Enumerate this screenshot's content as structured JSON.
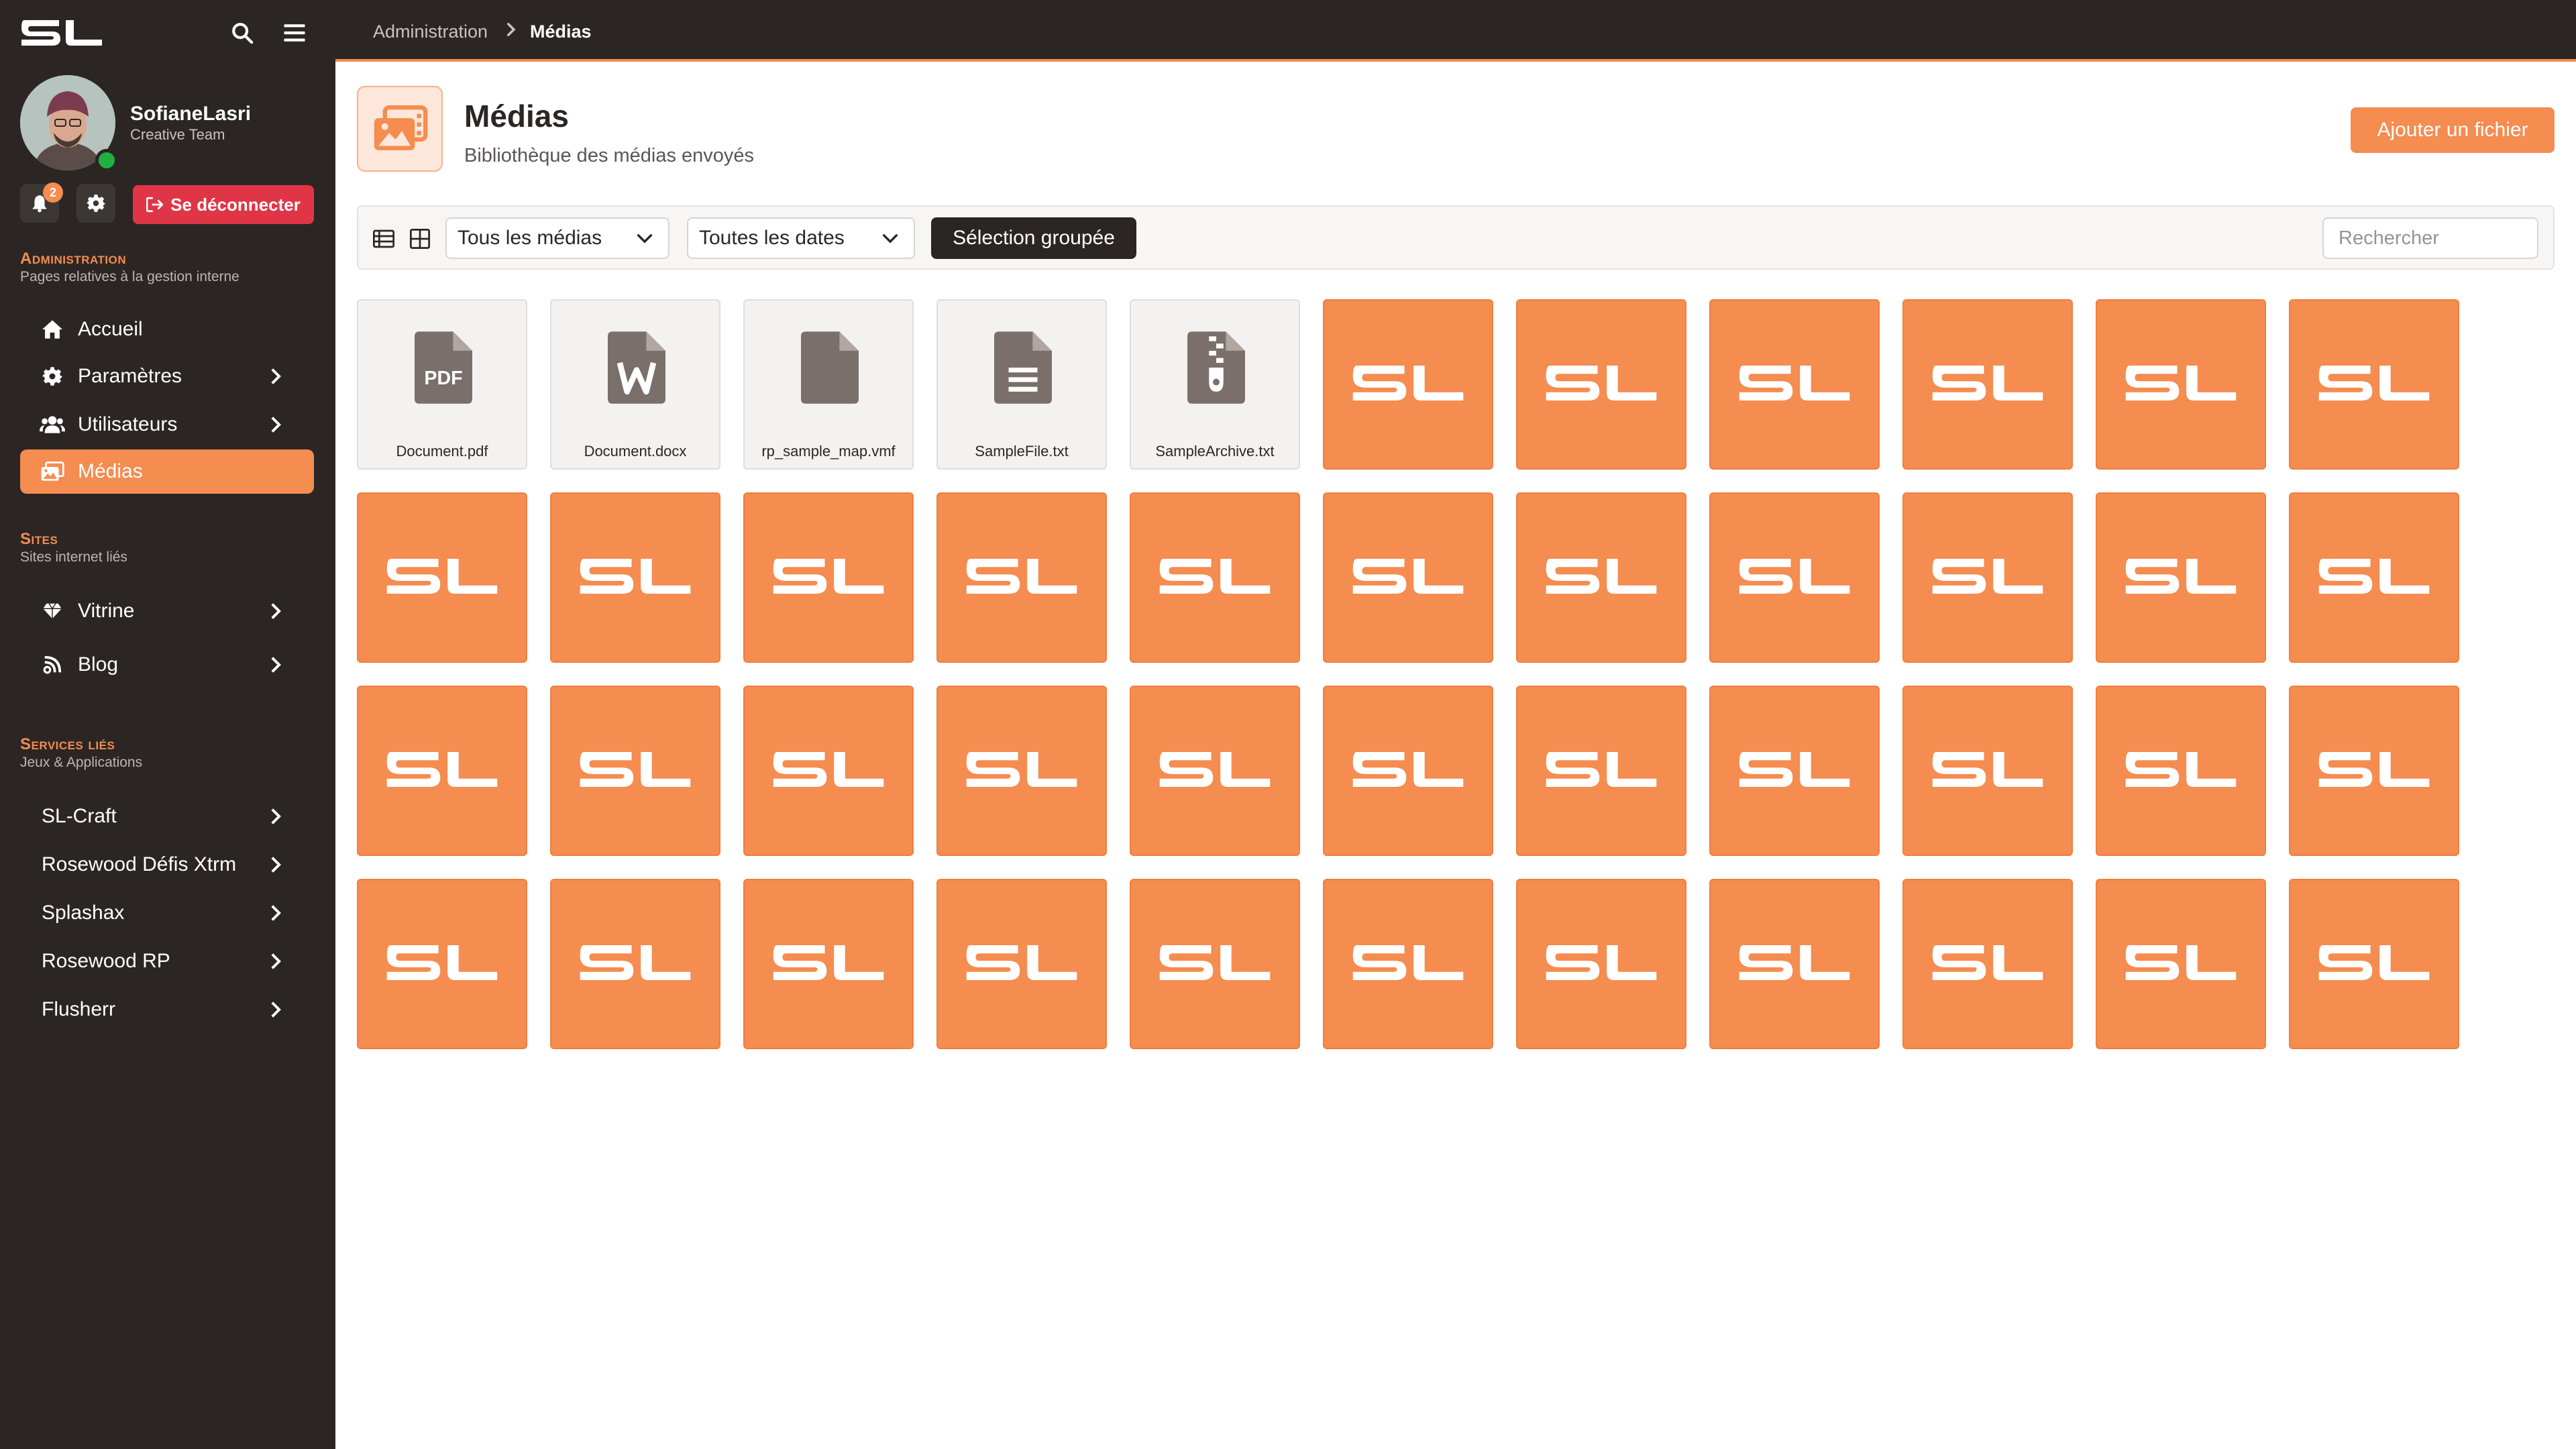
{
  "app": {
    "logo_text": "SL"
  },
  "breadcrumb": {
    "parent": "Administration",
    "current": "Médias"
  },
  "user": {
    "name": "SofianeLasri",
    "team": "Creative Team",
    "notifications": "2",
    "logout_label": "Se déconnecter"
  },
  "sidebar": {
    "sections": [
      {
        "title": "Administration",
        "subtitle": "Pages relatives à la gestion interne"
      },
      {
        "title": "Sites",
        "subtitle": "Sites internet liés"
      },
      {
        "title": "Services liés",
        "subtitle": "Jeux & Applications"
      }
    ],
    "admin_items": [
      {
        "label": "Accueil",
        "icon": "home-icon"
      },
      {
        "label": "Paramètres",
        "icon": "gear-icon"
      },
      {
        "label": "Utilisateurs",
        "icon": "users-icon"
      },
      {
        "label": "Médias",
        "icon": "images-icon"
      }
    ],
    "site_items": [
      {
        "label": "Vitrine",
        "icon": "gem-icon"
      },
      {
        "label": "Blog",
        "icon": "blog-icon"
      }
    ],
    "service_items": [
      {
        "label": "SL-Craft"
      },
      {
        "label": "Rosewood Défis Xtrm"
      },
      {
        "label": "Splashax"
      },
      {
        "label": "Rosewood RP"
      },
      {
        "label": "Flusherr"
      }
    ]
  },
  "page": {
    "title": "Médias",
    "subtitle": "Bibliothèque des médias envoyés",
    "add_button": "Ajouter un fichier"
  },
  "toolbar": {
    "type_filter": "Tous les médias",
    "date_filter": "Toutes les dates",
    "bulk_select": "Sélection groupée",
    "search_placeholder": "Rechercher"
  },
  "files": [
    {
      "name": "Document.pdf",
      "icon": "file-pdf-icon"
    },
    {
      "name": "Document.docx",
      "icon": "file-word-icon"
    },
    {
      "name": "rp_sample_map.vmf",
      "icon": "file-icon"
    },
    {
      "name": "SampleFile.txt",
      "icon": "file-text-icon"
    },
    {
      "name": "SampleArchive.txt",
      "icon": "file-archive-icon"
    }
  ],
  "image_tile_count": 39,
  "colors": {
    "accent": "#f58c50",
    "sidebar": "#2b2624",
    "danger": "#e03546",
    "online": "#1fb141"
  }
}
